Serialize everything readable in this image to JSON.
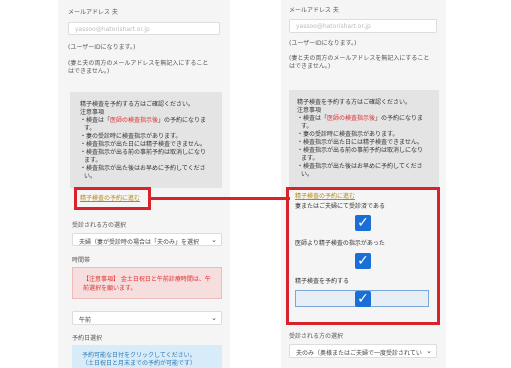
{
  "left": {
    "email_label": "メールアドレス 夫",
    "email_placeholder": "yassoo@hatorishart.or.jp",
    "userid_note": "(ユーザーIDになります。)",
    "email_note_1": "(妻と夫の両方のメールアドレスを無記入にすること",
    "email_note_2": "はできません。)",
    "notice_title": "精子検査を予約する方はご確認ください。",
    "notice_head": "注意事項",
    "notice_l1_pre": "・検査は「",
    "notice_l1_red": "医師の検査指示後",
    "notice_l1_post": "」の予約になりま",
    "notice_l2": "す。",
    "notice_l3": "・妻の受診時に検査指示があります。",
    "notice_l4": "・検査指示が出た日には精子検査できません。",
    "notice_l5": "・検査指示が出る前の事前予約は取消しになり",
    "notice_l6": "ます。",
    "notice_l7": "・検査指示が出た後はお早めに予約してくださ",
    "notice_l8": "い。",
    "link_text": "精子検査の予約に進む",
    "attendee_label": "受診される方の選択",
    "attendee_value": "夫婦（妻が受診時の場合は「夫のみ」を選択",
    "time_label": "時間帯",
    "alert_1": "【注意事項】 金土日祝日と午前診療時間は、午",
    "alert_2": "前選択を願います。",
    "time_value": "午前",
    "date_label": "予約日選択",
    "info_1": "予約可能な日付をクリックしてください。",
    "info_2": "（土日祝日と月末までの予約が可能です）"
  },
  "right": {
    "email_label": "メールアドレス 夫",
    "email_placeholder": "yassoo@hatorishart.or.jp",
    "userid_note": "(ユーザーIDになります。)",
    "email_note_1": "(妻と夫の両方のメールアドレスを無記入にすること",
    "email_note_2": "はできません。)",
    "notice_title": "精子検査を予約する方はご確認ください。",
    "notice_head": "注意事項",
    "notice_l1_pre": "・検査は「",
    "notice_l1_red": "医師の検査指示後",
    "notice_l1_post": "」の予約になりま",
    "notice_l2": "す。",
    "notice_l3": "・妻の受診時に検査指示があります。",
    "notice_l4": "・検査指示が出た日には精子検査できません。",
    "notice_l5": "・検査指示が出る前の事前予約は取消しになり",
    "notice_l6": "ます。",
    "notice_l7": "・検査指示が出た後はお早めに予約してくださ",
    "notice_l8": "い。",
    "link_text": "精子検査の予約に進む",
    "check1_label": "妻またはご夫婦にて受診済である",
    "check2_label": "医師より精子検査の指示があった",
    "check3_label": "精子検査を予約する",
    "attendee_label": "受診される方の選択",
    "attendee_value": "夫のみ（奥様またはご夫婦で一度受診されてい"
  },
  "colors": {
    "highlight": "#d9232b",
    "checkbox": "#1a6fd6"
  },
  "icons": {
    "check": "checkmark-icon",
    "select": "chevron-down-icon"
  }
}
